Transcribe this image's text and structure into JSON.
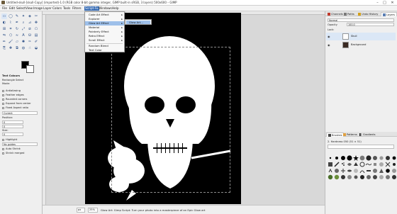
{
  "window": {
    "title": "Untitled-skull-[skull-Copy] (imported)-1.0 (RGB color 8-bit gamma integer, GIMP built-in sRGB, 3 layers) 500x600 – GIMP",
    "controls": {
      "minimize": "–",
      "maximize": "□",
      "close": "✕"
    }
  },
  "menubar": {
    "items": [
      "File",
      "Edit",
      "Select",
      "View",
      "Image",
      "Layer",
      "Colors",
      "Tools",
      "Filters",
      "Script-Fu",
      "Windows",
      "Help"
    ],
    "active": "Script-Fu"
  },
  "script_fu_menu": {
    "items": [
      {
        "label": "Code Art Effect",
        "submenu": true
      },
      {
        "label": "Explorer",
        "submenu": true
      },
      {
        "label": "Glow Art Effect",
        "submenu": true,
        "highlighted": true
      },
      {
        "label": "Material",
        "submenu": true
      },
      {
        "label": "Painterly Effect",
        "submenu": true
      },
      {
        "label": "Retro Effect",
        "submenu": true
      },
      {
        "label": "Scroll Effect",
        "submenu": true
      },
      {
        "label": "Random Blend",
        "submenu": false
      },
      {
        "label": "Text Color",
        "submenu": false
      }
    ],
    "arrow": "▸"
  },
  "submenu": {
    "items": [
      "Glow Art..."
    ]
  },
  "toolbox": {
    "panel_title": "Text Colours",
    "section_label": "Rectangle Select",
    "mode_label": "Mode:",
    "options": {
      "antialias": "Antialiasing",
      "feather": "Feather edges",
      "rounded": "Rounded corners",
      "expand": "Expand from center",
      "fixed": "Fixed Aspect ratio",
      "fixed_value": "Current",
      "position_label": "Position:",
      "position_value": "0",
      "size_label": "Size:",
      "size_value": "0",
      "highlight": "Highlight",
      "guides_label": "No guides",
      "autoshrink": "Auto Shrink",
      "shrink_merged": "Shrink merged"
    }
  },
  "statusbar": {
    "unit": "px",
    "zoom": "25%",
    "message": "Glow Art: Gimp Script: Turn your photo into a masterpiece of an Epic Glow art"
  },
  "right_dock": {
    "top_tabs": [
      "Channels",
      "Paths",
      "Undo History",
      "Layers"
    ],
    "mode_label": "Normal",
    "opacity_label": "Opacity",
    "opacity_value": "100.0",
    "lock_label": "Lock:",
    "layers": [
      {
        "name": "Skull",
        "thumb": "#ffffff",
        "selected": true
      },
      {
        "name": "Background",
        "thumb": "#3a2a22",
        "selected": false
      }
    ],
    "bottom_tabs": [
      "Brushes",
      "Patterns",
      "Gradients"
    ],
    "brush_name": "2. Hardness 050 (51 × 51)"
  }
}
